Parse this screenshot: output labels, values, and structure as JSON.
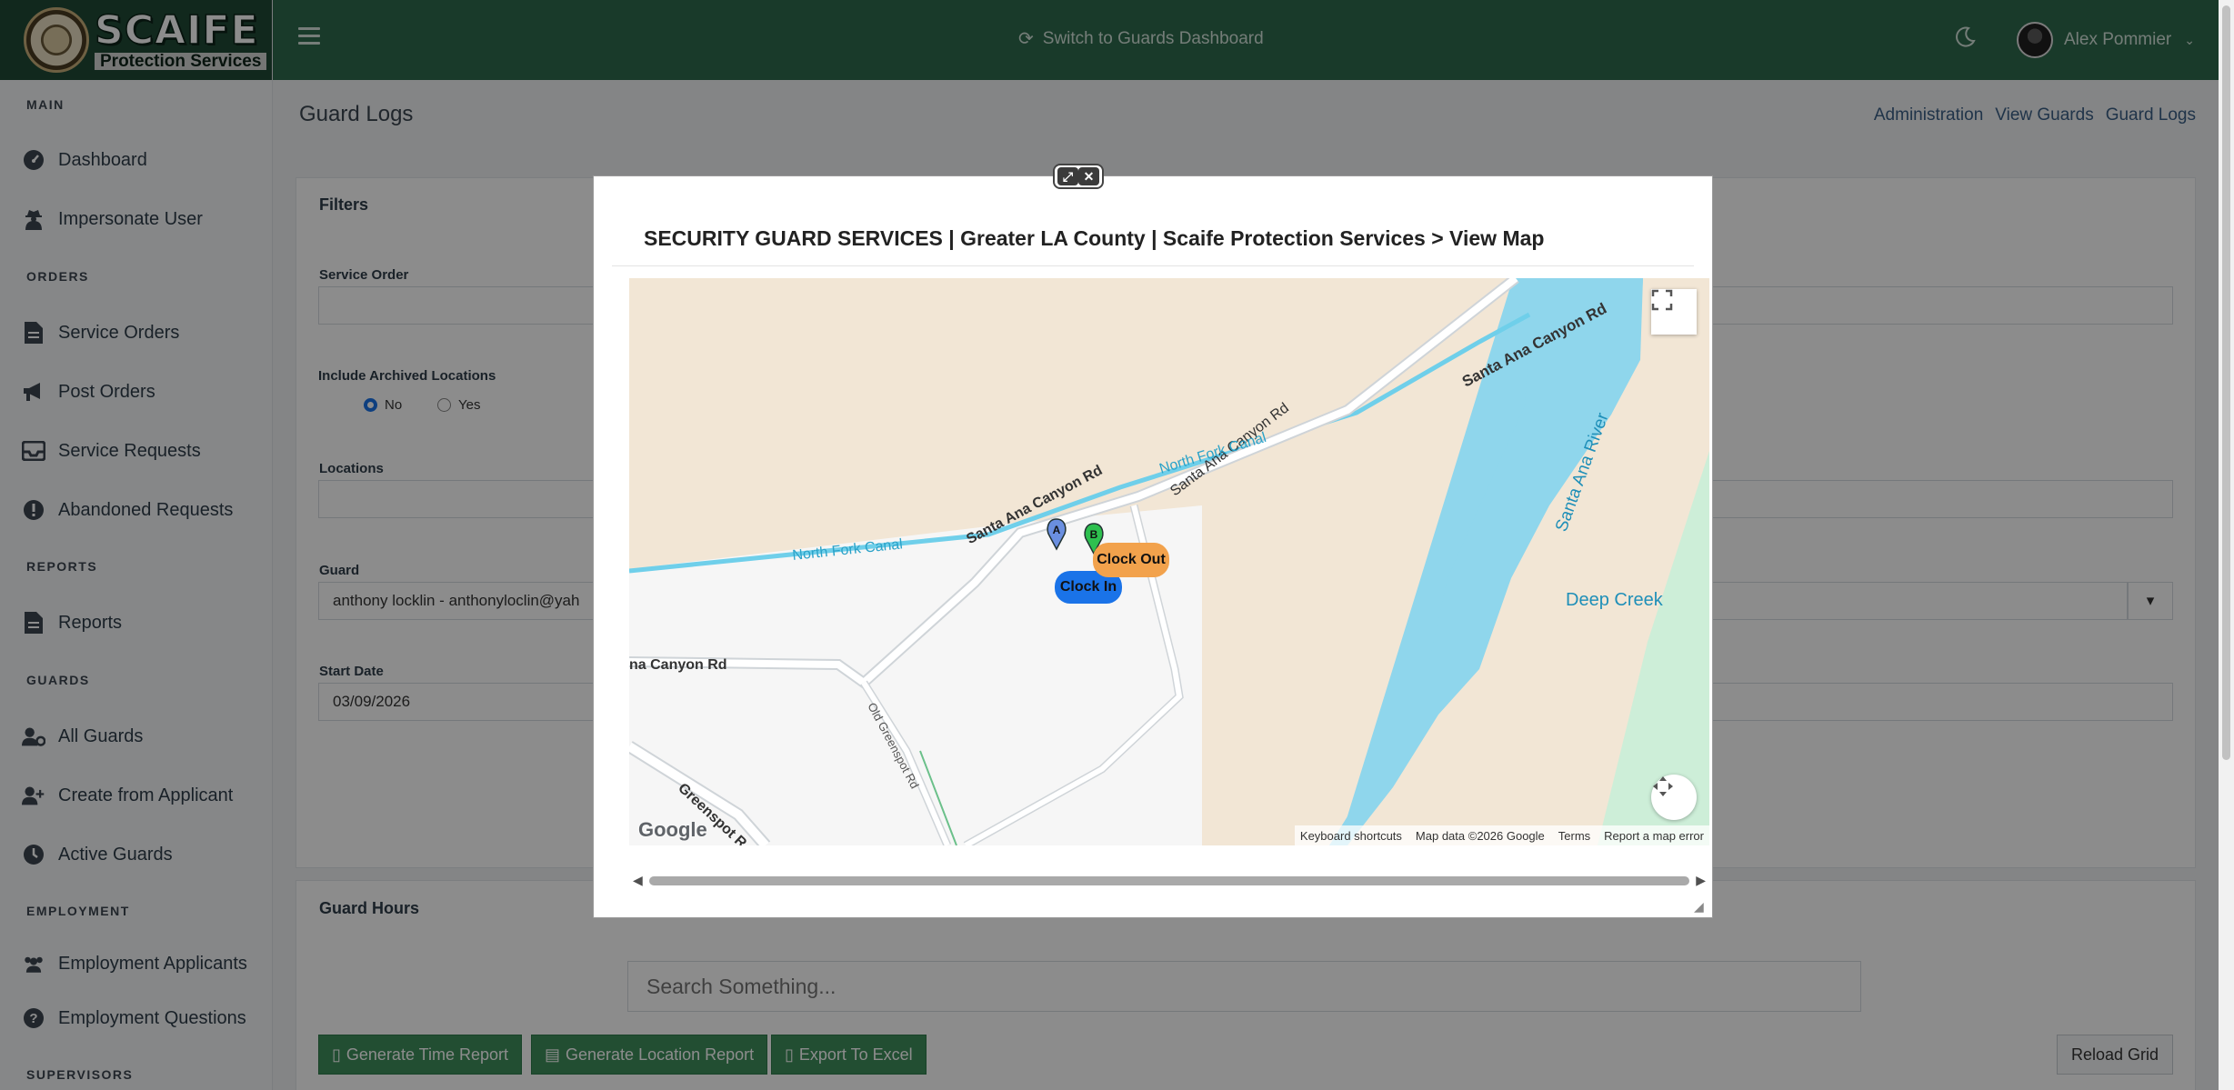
{
  "app": {
    "logo_main": "SCAIFE",
    "logo_sub": "Protection Services"
  },
  "sidebar": {
    "sections": [
      {
        "heading": "MAIN",
        "items": [
          {
            "label": "Dashboard",
            "icon": "dashboard-gauge-icon"
          },
          {
            "label": "Impersonate User",
            "icon": "user-secret-icon"
          }
        ]
      },
      {
        "heading": "ORDERS",
        "items": [
          {
            "label": "Service Orders",
            "icon": "file-document-icon"
          },
          {
            "label": "Post Orders",
            "icon": "megaphone-icon"
          },
          {
            "label": "Service Requests",
            "icon": "inbox-icon"
          },
          {
            "label": "Abandoned Requests",
            "icon": "exclamation-circle-icon"
          }
        ]
      },
      {
        "heading": "REPORTS",
        "items": [
          {
            "label": "Reports",
            "icon": "file-report-icon"
          }
        ]
      },
      {
        "heading": "GUARDS",
        "items": [
          {
            "label": "All Guards",
            "icon": "user-gear-icon"
          },
          {
            "label": "Create from Applicant",
            "icon": "user-plus-icon"
          },
          {
            "label": "Active Guards",
            "icon": "clock-icon"
          }
        ]
      },
      {
        "heading": "EMPLOYMENT",
        "items": [
          {
            "label": "Employment Applicants",
            "icon": "users-icon"
          },
          {
            "label": "Employment Questions",
            "icon": "question-circle-icon"
          }
        ]
      },
      {
        "heading": "SUPERVISORS",
        "items": []
      }
    ]
  },
  "topbar": {
    "switch_label": "Switch to Guards Dashboard",
    "user_name": "Alex Pommier"
  },
  "page": {
    "title": "Guard Logs",
    "breadcrumb": [
      "Administration",
      "View Guards",
      "Guard Logs"
    ]
  },
  "filters": {
    "title": "Filters",
    "service_order_label": "Service Order",
    "service_order_value": "",
    "archived_label": "Include Archived Locations",
    "archived_options": [
      "No",
      "Yes"
    ],
    "archived_selected": "No",
    "locations_label": "Locations",
    "locations_value": "",
    "guard_label": "Guard",
    "guard_value": "anthony locklin  - anthonyloclin@yah",
    "start_date_label": "Start Date",
    "start_date_value": "03/09/2026"
  },
  "hours": {
    "title": "Guard Hours",
    "search_placeholder": "Search Something...",
    "buttons": [
      "Generate Time Report",
      "Generate Location Report",
      "Export To Excel"
    ],
    "reload_label": "Reload Grid"
  },
  "modal": {
    "title": "SECURITY GUARD SERVICES | Greater LA County | Scaife Protection Services > View Map",
    "map": {
      "labels": {
        "santa_ana_canyon_rd": "Santa Ana Canyon Rd",
        "santa_ana_canyon_rd_partial": "na Canyon Rd",
        "north_fork_canal": "North Fork Canal",
        "santa_ana_river": "Santa Ana River",
        "deep_creek": "Deep Creek",
        "old_greenspot_rd": "Old Greenspot Rd",
        "greenspot_rd": "Greenspot R"
      },
      "markers": [
        {
          "letter": "A",
          "label": "Clock In",
          "color": "#1a73e8"
        },
        {
          "letter": "B",
          "label": "Clock Out",
          "color": "#f2a24c"
        }
      ],
      "google_logo": "Google",
      "attribution": [
        "Keyboard shortcuts",
        "Map data ©2026 Google",
        "Terms",
        "Report a map error"
      ]
    }
  }
}
